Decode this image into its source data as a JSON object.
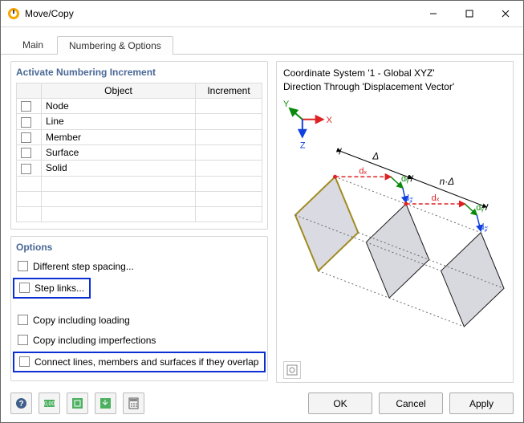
{
  "window": {
    "title": "Move/Copy"
  },
  "tabs": {
    "main": "Main",
    "numbering": "Numbering & Options"
  },
  "numbering": {
    "title": "Activate Numbering Increment",
    "cols": {
      "object": "Object",
      "increment": "Increment"
    },
    "rows": [
      {
        "name": "Node"
      },
      {
        "name": "Line"
      },
      {
        "name": "Member"
      },
      {
        "name": "Surface"
      },
      {
        "name": "Solid"
      }
    ]
  },
  "options": {
    "title": "Options",
    "diff_step": "Different step spacing...",
    "step_links": "Step links...",
    "copy_loading": "Copy including loading",
    "copy_imperfections": "Copy including imperfections",
    "connect_overlap": "Connect lines, members and surfaces if they overlap"
  },
  "preview": {
    "line1": "Coordinate System '1 - Global XYZ'",
    "line2": "Direction Through 'Displacement Vector'",
    "axes": {
      "x": "X",
      "y": "Y",
      "z": "Z"
    },
    "dims": {
      "d": "Δ",
      "nd": "n·Δ",
      "dx": "dₓ",
      "dy": "dᵧ",
      "dz": "d𝓏"
    }
  },
  "buttons": {
    "ok": "OK",
    "cancel": "Cancel",
    "apply": "Apply"
  }
}
